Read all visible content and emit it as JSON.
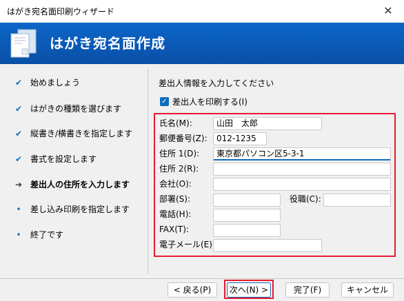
{
  "window": {
    "title": "はがき宛名面印刷ウィザード",
    "close_glyph": "✕"
  },
  "banner": {
    "heading": "はがき宛名面作成",
    "icon": "postcard-wizard-icon"
  },
  "steps": [
    {
      "label": "始めましょう",
      "state": "done",
      "mark": "✔"
    },
    {
      "label": "はがきの種類を選びます",
      "state": "done",
      "mark": "✔"
    },
    {
      "label": "縦書き/横書きを指定します",
      "state": "done",
      "mark": "✔"
    },
    {
      "label": "書式を設定します",
      "state": "done",
      "mark": "✔"
    },
    {
      "label": "差出人の住所を入力します",
      "state": "current",
      "mark": "➔"
    },
    {
      "label": "差し込み印刷を指定します",
      "state": "pending",
      "mark": "•"
    },
    {
      "label": "終了です",
      "state": "pending",
      "mark": "•"
    }
  ],
  "form": {
    "prompt": "差出人情報を入力してください",
    "print_sender": {
      "label": "差出人を印刷する(I)",
      "checked": true,
      "mark": "✓"
    },
    "fields": {
      "name": {
        "label": "氏名(M):",
        "value": "山田　太郎"
      },
      "postal": {
        "label": "郵便番号(Z):",
        "value": "012-1235"
      },
      "address1": {
        "label": "住所 1(D):",
        "value": "東京都パソコン区5-3-1"
      },
      "address2": {
        "label": "住所 2(R):",
        "value": ""
      },
      "company": {
        "label": "会社(O):",
        "value": ""
      },
      "department": {
        "label": "部署(S):",
        "value": ""
      },
      "title": {
        "label": "役職(C):",
        "value": ""
      },
      "phone": {
        "label": "電話(H):",
        "value": ""
      },
      "fax": {
        "label": "FAX(T):",
        "value": ""
      },
      "email": {
        "label": "電子メール(E)",
        "value": ""
      }
    }
  },
  "buttons": {
    "back": "< 戻る(P)",
    "next": "次へ(N) >",
    "finish": "完了(F)",
    "cancel": "キャンセル"
  },
  "colors": {
    "accent": "#0f6cbd",
    "highlight": "#e6192f",
    "banner": "#0a5ab8"
  }
}
